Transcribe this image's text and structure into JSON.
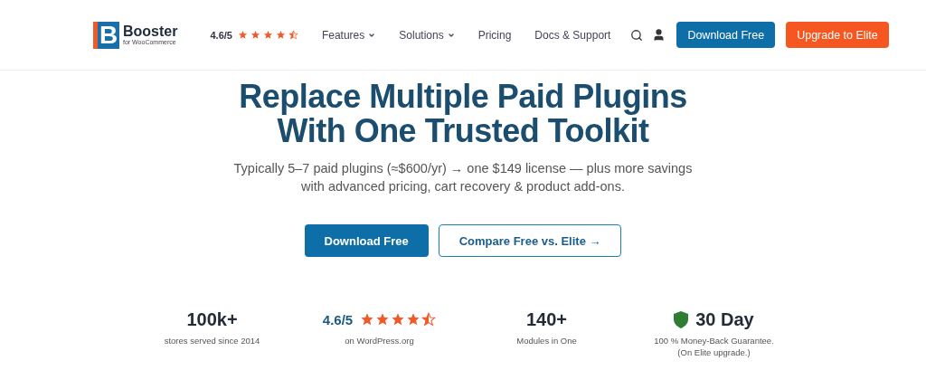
{
  "header": {
    "logo": {
      "letter": "B",
      "name": "Booster",
      "tagline": "for WooCommerce"
    },
    "rating": {
      "score": "4.6/5",
      "stars": 4.5
    },
    "nav": [
      {
        "label": "Features",
        "dropdown": true
      },
      {
        "label": "Solutions",
        "dropdown": true
      },
      {
        "label": "Pricing",
        "dropdown": false
      },
      {
        "label": "Docs & Support",
        "dropdown": false
      }
    ],
    "buttons": [
      {
        "label": "Download Free",
        "kind": "primary"
      },
      {
        "label": "Upgrade to Elite",
        "kind": "accent"
      }
    ]
  },
  "hero": {
    "title_lines": [
      "Replace Multiple Paid Plugins",
      "With One Trusted Toolkit"
    ],
    "subtitle_lines": [
      "Typically 5–7 paid plugins (≈$600/yr) → one $149 license — plus more savings",
      "with advanced pricing, cart recovery & product add-ons."
    ],
    "buttons": [
      {
        "label": "Download Free",
        "kind": "primary"
      },
      {
        "label": "Compare Free vs. Elite →",
        "kind": "outline"
      }
    ]
  },
  "stats": [
    {
      "kind": "plain",
      "value": "100k+",
      "caption_lines": [
        "stores served since 2014"
      ]
    },
    {
      "kind": "rating",
      "value": "4.6/5",
      "stars": 4.5,
      "caption_lines": [
        "on WordPress.org"
      ]
    },
    {
      "kind": "plain",
      "value": "140+",
      "caption_lines": [
        "Modules in One"
      ]
    },
    {
      "kind": "shield",
      "value": "30 Day",
      "caption_lines": [
        "100 % Money-Back Guarantee.",
        "(On Elite upgrade.)"
      ]
    }
  ]
}
